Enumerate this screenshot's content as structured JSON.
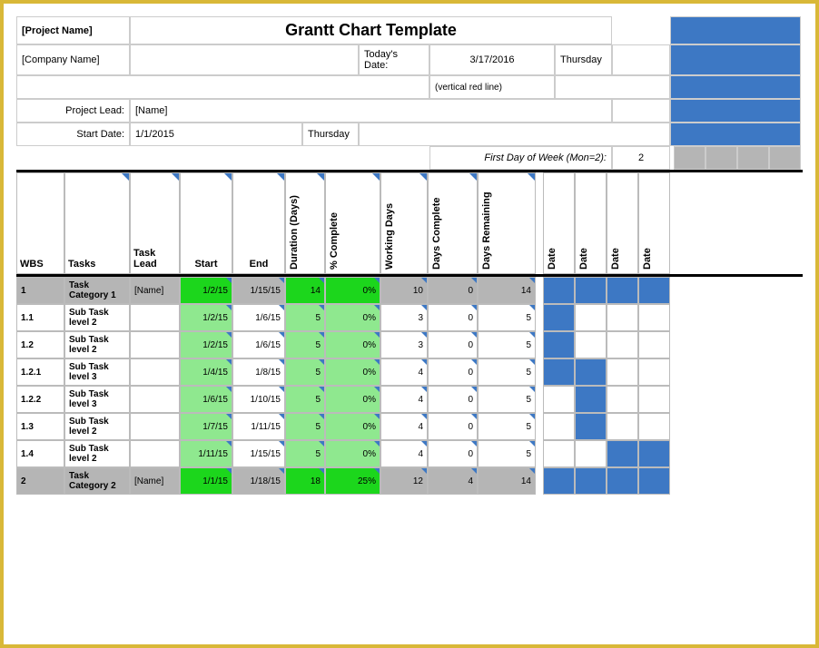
{
  "chart_data": {
    "type": "table",
    "title": "Grantt Chart Template",
    "project_name": "[Project Name]",
    "company_name": "[Company Name]",
    "todays_date_label": "Today's Date:",
    "todays_date": "3/17/2016",
    "today_day": "Thursday",
    "red_line_note": "(vertical red line)",
    "project_lead_label": "Project Lead:",
    "project_lead": "[Name]",
    "start_date_label": "Start Date:",
    "start_date": "1/1/2015",
    "start_day": "Thursday",
    "first_day_label": "First Day of Week (Mon=2):",
    "first_day_value": "2",
    "cols": {
      "wbs": "WBS",
      "tasks": "Tasks",
      "lead": "Task Lead",
      "start": "Start",
      "end": "End",
      "dur": "Duration (Days)",
      "pct": "% Complete",
      "wd": "Working Days",
      "dc": "Days Complete",
      "dr": "Days Remaining",
      "date": "Date"
    },
    "rows": [
      {
        "wbs": "1",
        "task": "Task Category 1",
        "lead": "[Name]",
        "start": "1/2/15",
        "end": "1/15/15",
        "dur": "14",
        "pct": "0%",
        "wd": "10",
        "dc": "0",
        "dr": "14",
        "cat": true,
        "bars": [
          0,
          1,
          2,
          3
        ]
      },
      {
        "wbs": "1.1",
        "task": "Sub Task level 2",
        "lead": "",
        "start": "1/2/15",
        "end": "1/6/15",
        "dur": "5",
        "pct": "0%",
        "wd": "3",
        "dc": "0",
        "dr": "5",
        "bars": [
          0
        ]
      },
      {
        "wbs": "1.2",
        "task": "Sub Task level 2",
        "lead": "",
        "start": "1/2/15",
        "end": "1/6/15",
        "dur": "5",
        "pct": "0%",
        "wd": "3",
        "dc": "0",
        "dr": "5",
        "bars": [
          0
        ]
      },
      {
        "wbs": "1.2.1",
        "task": "Sub Task level 3",
        "lead": "",
        "start": "1/4/15",
        "end": "1/8/15",
        "dur": "5",
        "pct": "0%",
        "wd": "4",
        "dc": "0",
        "dr": "5",
        "bars": [
          0,
          1
        ]
      },
      {
        "wbs": "1.2.2",
        "task": "Sub Task level 3",
        "lead": "",
        "start": "1/6/15",
        "end": "1/10/15",
        "dur": "5",
        "pct": "0%",
        "wd": "4",
        "dc": "0",
        "dr": "5",
        "bars": [
          1
        ]
      },
      {
        "wbs": "1.3",
        "task": "Sub Task level 2",
        "lead": "",
        "start": "1/7/15",
        "end": "1/11/15",
        "dur": "5",
        "pct": "0%",
        "wd": "4",
        "dc": "0",
        "dr": "5",
        "bars": [
          1
        ]
      },
      {
        "wbs": "1.4",
        "task": "Sub Task level 2",
        "lead": "",
        "start": "1/11/15",
        "end": "1/15/15",
        "dur": "5",
        "pct": "0%",
        "wd": "4",
        "dc": "0",
        "dr": "5",
        "bars": [
          2,
          3
        ]
      },
      {
        "wbs": "2",
        "task": "Task Category 2",
        "lead": "[Name]",
        "start": "1/1/15",
        "end": "1/18/15",
        "dur": "18",
        "pct": "25%",
        "wd": "12",
        "dc": "4",
        "dr": "14",
        "cat": true,
        "bars": [
          0,
          1,
          2,
          3
        ]
      }
    ]
  }
}
